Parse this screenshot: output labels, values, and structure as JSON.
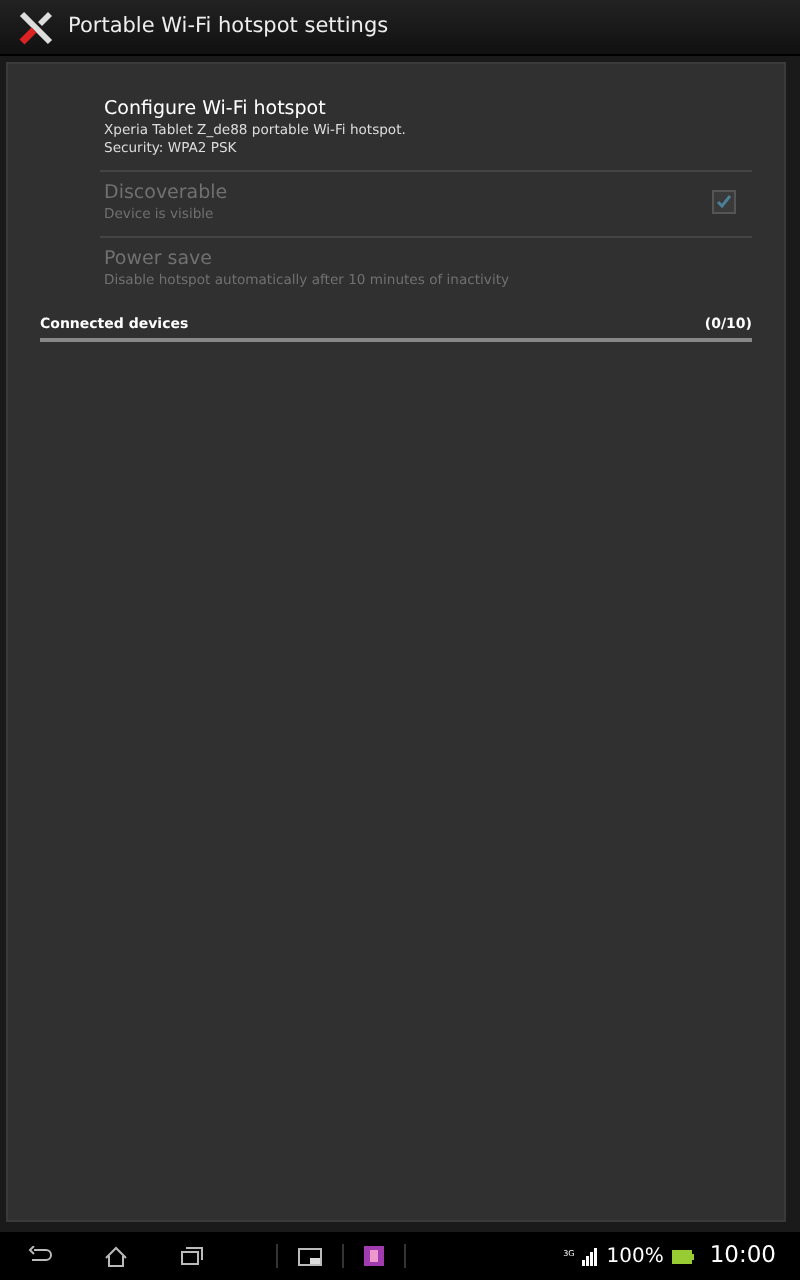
{
  "action_bar": {
    "title": "Portable Wi-Fi hotspot settings"
  },
  "preferences": [
    {
      "kind": "plain",
      "title": "Configure Wi-Fi hotspot",
      "summary": [
        "Xperia Tablet Z_de88 portable Wi-Fi hotspot.",
        "Security: WPA2 PSK"
      ],
      "disabled": false
    },
    {
      "kind": "checkbox",
      "title": "Discoverable",
      "summary": [
        "Device is visible"
      ],
      "disabled": true,
      "checked": true
    },
    {
      "kind": "plain",
      "title": "Power save",
      "summary": [
        "Disable hotspot automatically after 10 minutes of inactivity"
      ],
      "disabled": true
    }
  ],
  "section": {
    "title": "Connected devices",
    "count": "(0/10)"
  },
  "status_bar": {
    "network": "3G",
    "battery": "100%",
    "time": "10:00"
  }
}
